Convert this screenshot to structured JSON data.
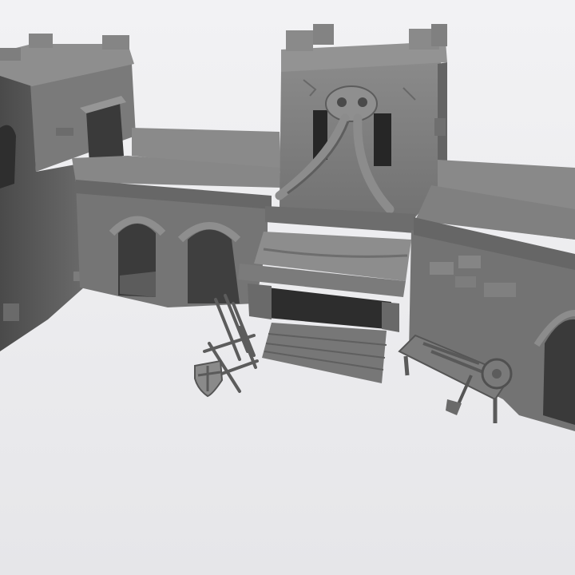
{
  "scene": {
    "subject": "fortress-3d-model-render",
    "colors": {
      "background_top": "#f2f2f4",
      "background_bottom": "#e6e6e9",
      "stone_light": "#8c8c8c",
      "stone_mid": "#777777",
      "stone_dark": "#5a5a5a",
      "stone_shadow": "#3c3c3c",
      "wood": "#6e6e6e",
      "opening": "#2a2a2a"
    }
  }
}
